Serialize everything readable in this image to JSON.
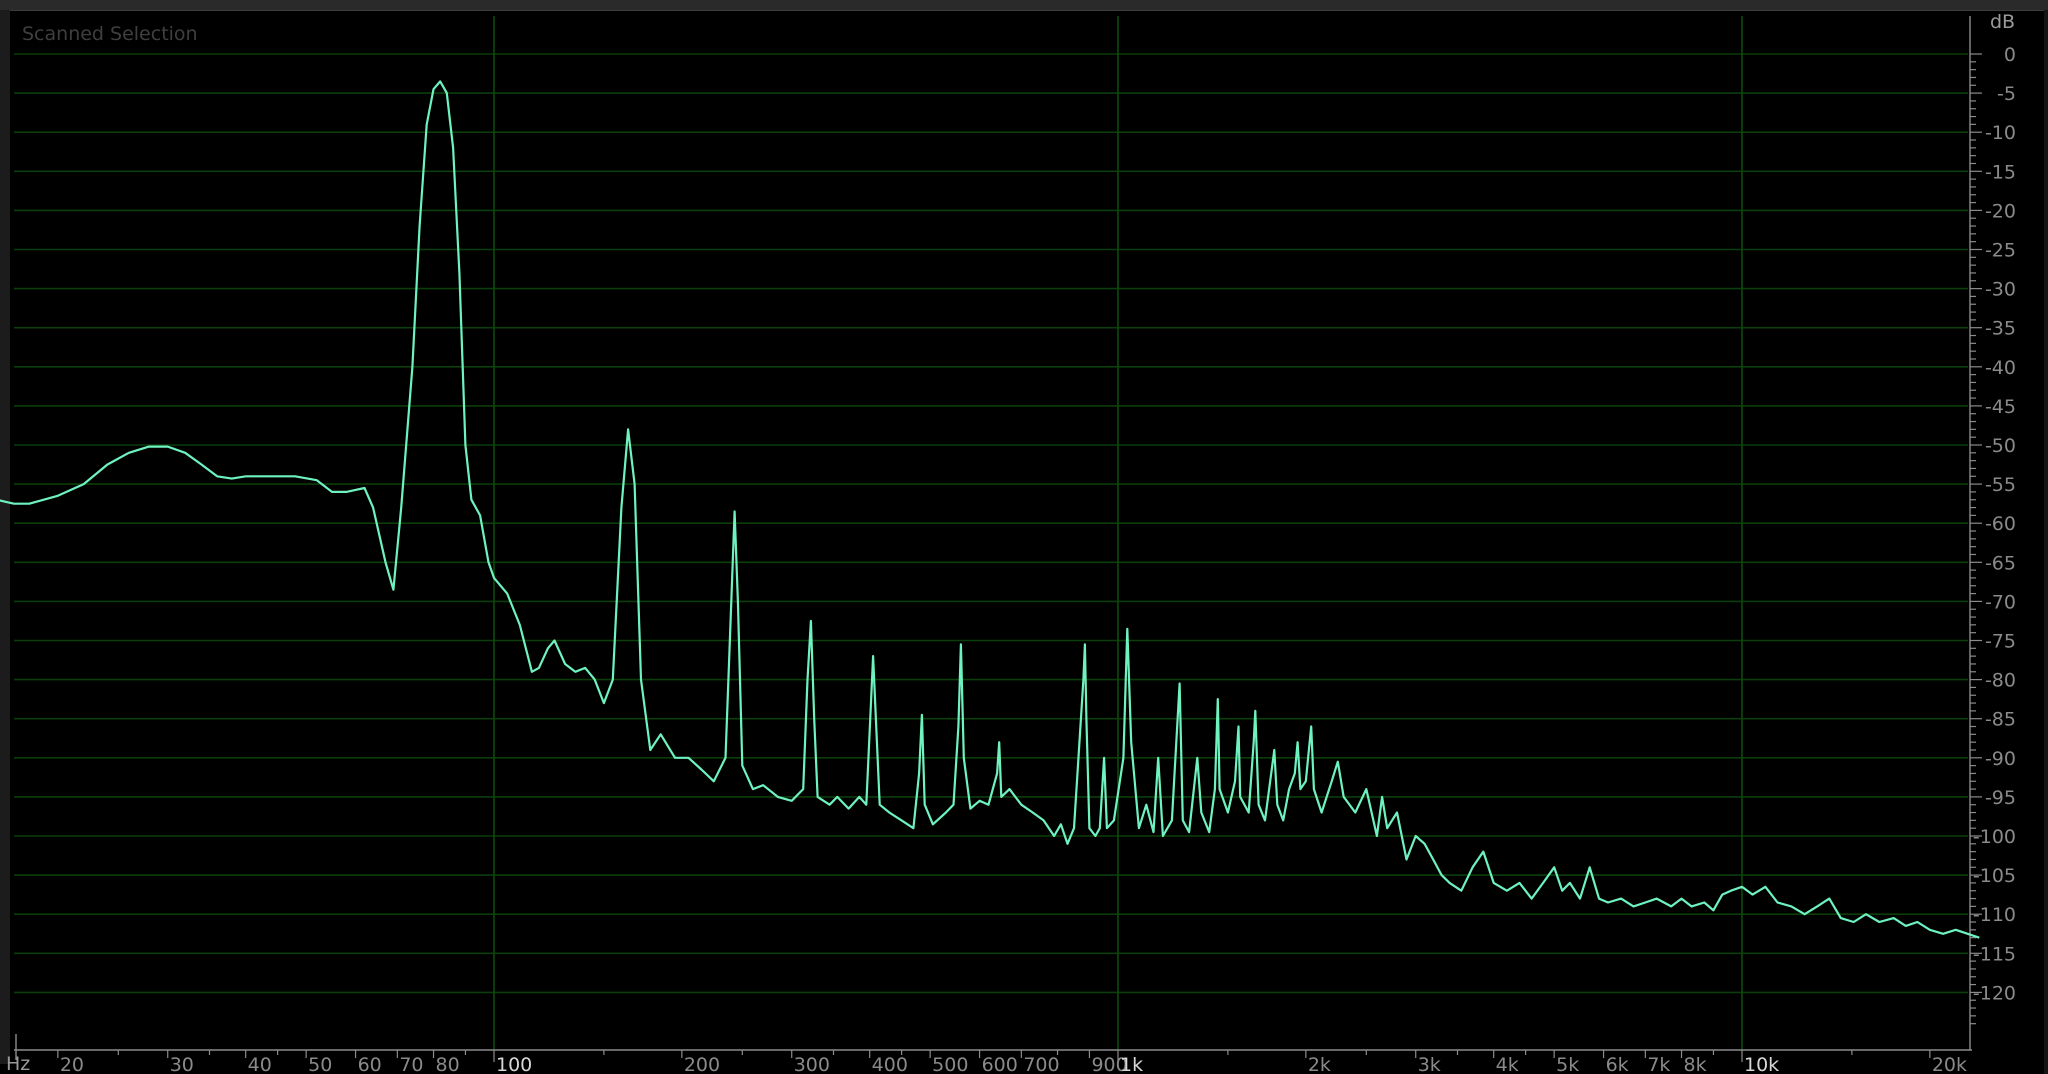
{
  "panel": {
    "title": "Scanned Selection",
    "y_unit": "dB",
    "x_unit": "Hz"
  },
  "colors": {
    "background": "#000000",
    "grid": "#0c4a0c",
    "curve": "#6ef2c0",
    "tick_text": "#8a8a8a"
  },
  "chart_data": {
    "type": "line",
    "title": "Scanned Selection",
    "xlabel": "Hz",
    "ylabel": "dB",
    "x_scale": "log",
    "xlim": [
      15,
      24000
    ],
    "ylim": [
      -125,
      2
    ],
    "grid": true,
    "y_ticks": [
      {
        "value": 0,
        "label": "0"
      },
      {
        "value": -5,
        "label": "-5"
      },
      {
        "value": -10,
        "label": "-10"
      },
      {
        "value": -15,
        "label": "-15"
      },
      {
        "value": -20,
        "label": "-20"
      },
      {
        "value": -25,
        "label": "-25"
      },
      {
        "value": -30,
        "label": "-30"
      },
      {
        "value": -35,
        "label": "-35"
      },
      {
        "value": -40,
        "label": "-40"
      },
      {
        "value": -45,
        "label": "-45"
      },
      {
        "value": -50,
        "label": "-50"
      },
      {
        "value": -55,
        "label": "-55"
      },
      {
        "value": -60,
        "label": "-60"
      },
      {
        "value": -65,
        "label": "-65"
      },
      {
        "value": -70,
        "label": "-70"
      },
      {
        "value": -75,
        "label": "-75"
      },
      {
        "value": -80,
        "label": "-80"
      },
      {
        "value": -85,
        "label": "-85"
      },
      {
        "value": -90,
        "label": "-90"
      },
      {
        "value": -95,
        "label": "-95"
      },
      {
        "value": -100,
        "label": "-100"
      },
      {
        "value": -105,
        "label": "-105"
      },
      {
        "value": -110,
        "label": "-110"
      },
      {
        "value": -115,
        "label": "-115"
      },
      {
        "value": -120,
        "label": "-120"
      }
    ],
    "x_ticks": [
      {
        "value": 20,
        "label": "20",
        "major": false
      },
      {
        "value": 30,
        "label": "30",
        "major": false
      },
      {
        "value": 40,
        "label": "40",
        "major": false
      },
      {
        "value": 50,
        "label": "50",
        "major": false
      },
      {
        "value": 60,
        "label": "60",
        "major": false
      },
      {
        "value": 70,
        "label": "70",
        "major": false
      },
      {
        "value": 80,
        "label": "80",
        "major": false
      },
      {
        "value": 100,
        "label": "100",
        "major": true
      },
      {
        "value": 200,
        "label": "200",
        "major": false
      },
      {
        "value": 300,
        "label": "300",
        "major": false
      },
      {
        "value": 400,
        "label": "400",
        "major": false
      },
      {
        "value": 500,
        "label": "500",
        "major": false
      },
      {
        "value": 600,
        "label": "600",
        "major": false
      },
      {
        "value": 700,
        "label": "700",
        "major": false
      },
      {
        "value": 900,
        "label": "900",
        "major": false
      },
      {
        "value": 1000,
        "label": "1k",
        "major": true
      },
      {
        "value": 2000,
        "label": "2k",
        "major": false
      },
      {
        "value": 3000,
        "label": "3k",
        "major": false
      },
      {
        "value": 4000,
        "label": "4k",
        "major": false
      },
      {
        "value": 5000,
        "label": "5k",
        "major": false
      },
      {
        "value": 6000,
        "label": "6k",
        "major": false
      },
      {
        "value": 7000,
        "label": "7k",
        "major": false
      },
      {
        "value": 8000,
        "label": "8k",
        "major": false
      },
      {
        "value": 10000,
        "label": "10k",
        "major": true
      },
      {
        "value": 20000,
        "label": "20k",
        "major": false
      }
    ],
    "major_gridlines_x": [
      100,
      1000,
      10000
    ],
    "series": [
      {
        "points": [
          [
            15,
            -56.5
          ],
          [
            17,
            -57.5
          ],
          [
            18,
            -57.5
          ],
          [
            20,
            -56.5
          ],
          [
            22,
            -55
          ],
          [
            24,
            -52.5
          ],
          [
            26,
            -51
          ],
          [
            28,
            -50.2
          ],
          [
            30,
            -50.2
          ],
          [
            32,
            -51
          ],
          [
            34,
            -52.5
          ],
          [
            36,
            -54
          ],
          [
            38,
            -54.3
          ],
          [
            40,
            -54
          ],
          [
            44,
            -54
          ],
          [
            48,
            -54
          ],
          [
            52,
            -54.5
          ],
          [
            55,
            -56
          ],
          [
            58,
            -56
          ],
          [
            62,
            -55.5
          ],
          [
            64,
            -58
          ],
          [
            67,
            -65
          ],
          [
            69,
            -68.5
          ],
          [
            71,
            -58
          ],
          [
            74,
            -40
          ],
          [
            76,
            -22
          ],
          [
            78,
            -9
          ],
          [
            80,
            -4.5
          ],
          [
            82,
            -3.5
          ],
          [
            84,
            -5
          ],
          [
            86,
            -12
          ],
          [
            88,
            -28
          ],
          [
            90,
            -50
          ],
          [
            92,
            -57
          ],
          [
            95,
            -59
          ],
          [
            98,
            -65
          ],
          [
            100,
            -67
          ],
          [
            105,
            -69
          ],
          [
            110,
            -73
          ],
          [
            115,
            -79
          ],
          [
            118,
            -78.5
          ],
          [
            122,
            -76
          ],
          [
            125,
            -75
          ],
          [
            130,
            -78
          ],
          [
            135,
            -79
          ],
          [
            140,
            -78.5
          ],
          [
            145,
            -80
          ],
          [
            150,
            -83
          ],
          [
            155,
            -80
          ],
          [
            160,
            -58
          ],
          [
            164,
            -48
          ],
          [
            168,
            -55
          ],
          [
            172,
            -80
          ],
          [
            178,
            -89
          ],
          [
            185,
            -87
          ],
          [
            195,
            -90
          ],
          [
            205,
            -90
          ],
          [
            215,
            -91.5
          ],
          [
            225,
            -93
          ],
          [
            235,
            -90
          ],
          [
            240,
            -70
          ],
          [
            243,
            -58.5
          ],
          [
            246,
            -70
          ],
          [
            250,
            -91
          ],
          [
            260,
            -94
          ],
          [
            270,
            -93.5
          ],
          [
            285,
            -95
          ],
          [
            300,
            -95.5
          ],
          [
            313,
            -94
          ],
          [
            318,
            -80
          ],
          [
            322,
            -72.5
          ],
          [
            326,
            -85
          ],
          [
            330,
            -95
          ],
          [
            345,
            -96
          ],
          [
            355,
            -95
          ],
          [
            370,
            -96.5
          ],
          [
            385,
            -95
          ],
          [
            395,
            -96
          ],
          [
            405,
            -77
          ],
          [
            415,
            -96
          ],
          [
            430,
            -97
          ],
          [
            450,
            -98
          ],
          [
            470,
            -99
          ],
          [
            480,
            -92
          ],
          [
            485,
            -84.5
          ],
          [
            490,
            -96
          ],
          [
            505,
            -98.5
          ],
          [
            530,
            -97
          ],
          [
            545,
            -96
          ],
          [
            555,
            -86
          ],
          [
            560,
            -75.5
          ],
          [
            566,
            -90
          ],
          [
            580,
            -96.5
          ],
          [
            600,
            -95.5
          ],
          [
            620,
            -96
          ],
          [
            640,
            -92
          ],
          [
            645,
            -88
          ],
          [
            650,
            -95
          ],
          [
            670,
            -94
          ],
          [
            700,
            -96
          ],
          [
            730,
            -97
          ],
          [
            760,
            -98
          ],
          [
            790,
            -100
          ],
          [
            810,
            -98.5
          ],
          [
            830,
            -101
          ],
          [
            850,
            -99
          ],
          [
            880,
            -80
          ],
          [
            885,
            -75.5
          ],
          [
            890,
            -85
          ],
          [
            900,
            -99
          ],
          [
            920,
            -100
          ],
          [
            935,
            -99
          ],
          [
            950,
            -90
          ],
          [
            960,
            -99
          ],
          [
            985,
            -98
          ],
          [
            1020,
            -90
          ],
          [
            1035,
            -73.5
          ],
          [
            1050,
            -88
          ],
          [
            1080,
            -99
          ],
          [
            1110,
            -96
          ],
          [
            1140,
            -99.5
          ],
          [
            1160,
            -90
          ],
          [
            1180,
            -100
          ],
          [
            1220,
            -98
          ],
          [
            1255,
            -80.5
          ],
          [
            1270,
            -98
          ],
          [
            1300,
            -99.5
          ],
          [
            1340,
            -90
          ],
          [
            1360,
            -97
          ],
          [
            1400,
            -99.5
          ],
          [
            1430,
            -94
          ],
          [
            1445,
            -82.5
          ],
          [
            1455,
            -94
          ],
          [
            1500,
            -97
          ],
          [
            1540,
            -93
          ],
          [
            1560,
            -86
          ],
          [
            1570,
            -95
          ],
          [
            1620,
            -97
          ],
          [
            1650,
            -88
          ],
          [
            1660,
            -84
          ],
          [
            1680,
            -96
          ],
          [
            1720,
            -98
          ],
          [
            1780,
            -89
          ],
          [
            1800,
            -96
          ],
          [
            1840,
            -98
          ],
          [
            1880,
            -94
          ],
          [
            1920,
            -92
          ],
          [
            1940,
            -88
          ],
          [
            1960,
            -94
          ],
          [
            2000,
            -93
          ],
          [
            2040,
            -86
          ],
          [
            2060,
            -94
          ],
          [
            2120,
            -97
          ],
          [
            2200,
            -93
          ],
          [
            2250,
            -90.5
          ],
          [
            2300,
            -95
          ],
          [
            2400,
            -97
          ],
          [
            2500,
            -94
          ],
          [
            2600,
            -100
          ],
          [
            2650,
            -95
          ],
          [
            2700,
            -99
          ],
          [
            2800,
            -97
          ],
          [
            2900,
            -103
          ],
          [
            3000,
            -100
          ],
          [
            3100,
            -101
          ],
          [
            3200,
            -103
          ],
          [
            3300,
            -105
          ],
          [
            3400,
            -106
          ],
          [
            3550,
            -107
          ],
          [
            3700,
            -104
          ],
          [
            3850,
            -102
          ],
          [
            4000,
            -106
          ],
          [
            4200,
            -107
          ],
          [
            4400,
            -106
          ],
          [
            4600,
            -108
          ],
          [
            4800,
            -106
          ],
          [
            5000,
            -104
          ],
          [
            5150,
            -107
          ],
          [
            5300,
            -106
          ],
          [
            5500,
            -108
          ],
          [
            5700,
            -104
          ],
          [
            5900,
            -108
          ],
          [
            6100,
            -108.5
          ],
          [
            6400,
            -108
          ],
          [
            6700,
            -109
          ],
          [
            7000,
            -108.5
          ],
          [
            7300,
            -108
          ],
          [
            7700,
            -109
          ],
          [
            8000,
            -108
          ],
          [
            8300,
            -109
          ],
          [
            8700,
            -108.5
          ],
          [
            9000,
            -109.5
          ],
          [
            9300,
            -107.5
          ],
          [
            9600,
            -107
          ],
          [
            10000,
            -106.5
          ],
          [
            10400,
            -107.5
          ],
          [
            10900,
            -106.5
          ],
          [
            11400,
            -108.5
          ],
          [
            12000,
            -109
          ],
          [
            12600,
            -110
          ],
          [
            13200,
            -109
          ],
          [
            13800,
            -108
          ],
          [
            14400,
            -110.5
          ],
          [
            15100,
            -111
          ],
          [
            15800,
            -110
          ],
          [
            16600,
            -111
          ],
          [
            17500,
            -110.5
          ],
          [
            18300,
            -111.5
          ],
          [
            19100,
            -111
          ],
          [
            20000,
            -112
          ],
          [
            21000,
            -112.5
          ],
          [
            22000,
            -112
          ],
          [
            23000,
            -112.5
          ],
          [
            24000,
            -113
          ]
        ]
      }
    ]
  }
}
